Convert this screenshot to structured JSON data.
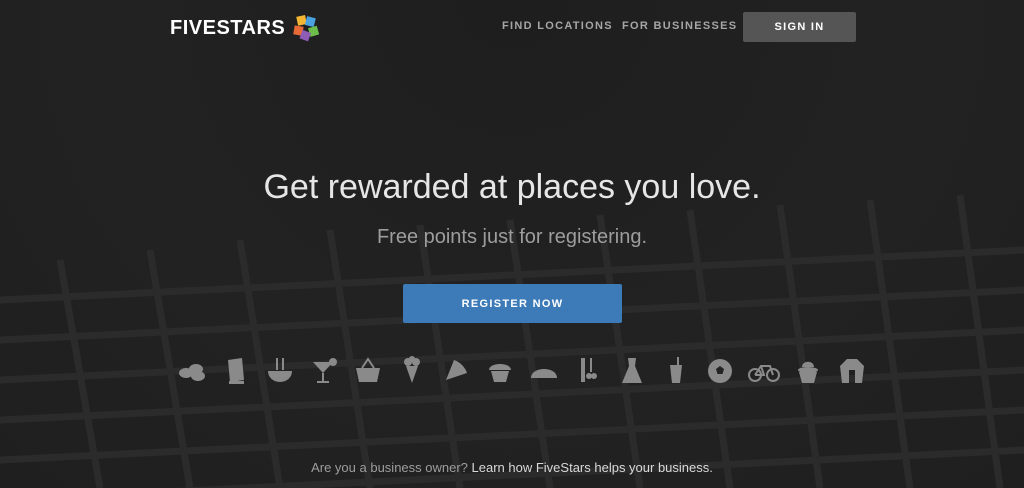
{
  "brand": {
    "name": "FIVESTARS"
  },
  "header": {
    "nav": [
      {
        "label": "FIND LOCATIONS"
      },
      {
        "label": "FOR BUSINESSES"
      }
    ],
    "signin_label": "SIGN IN"
  },
  "hero": {
    "headline": "Get rewarded at places you love.",
    "subline": "Free points just for registering.",
    "cta_label": "REGISTER NOW"
  },
  "categories": [
    {
      "icon": "bakery-icon"
    },
    {
      "icon": "books-icon"
    },
    {
      "icon": "noodle-bowl-icon"
    },
    {
      "icon": "cocktail-icon"
    },
    {
      "icon": "grocery-basket-icon"
    },
    {
      "icon": "flowers-icon"
    },
    {
      "icon": "pizza-icon"
    },
    {
      "icon": "cupcake-icon"
    },
    {
      "icon": "taco-icon"
    },
    {
      "icon": "salon-icon"
    },
    {
      "icon": "dress-icon"
    },
    {
      "icon": "drink-cup-icon"
    },
    {
      "icon": "soccer-ball-icon"
    },
    {
      "icon": "bicycle-icon"
    },
    {
      "icon": "frozen-yogurt-icon"
    },
    {
      "icon": "jacket-icon"
    }
  ],
  "footer": {
    "question": "Are you a business owner?",
    "link": "Learn how FiveStars helps your business."
  },
  "colors": {
    "background": "#232323",
    "cta": "#3c7ab8",
    "signin": "#555555",
    "icon": "#8a8a8a"
  }
}
